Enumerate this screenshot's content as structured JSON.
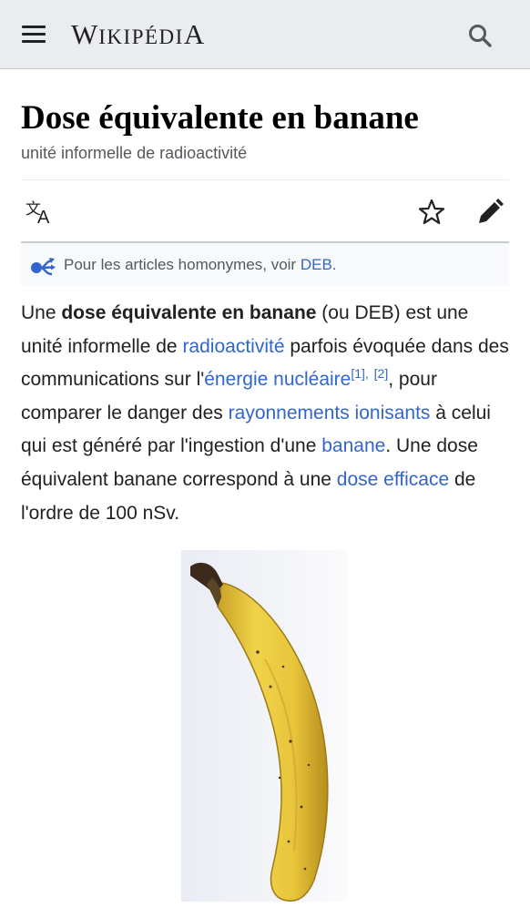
{
  "header": {
    "wordmark_first": "W",
    "wordmark_rest": "IKIPÉDI",
    "wordmark_last": "A",
    "menu_icon": "hamburger-menu-icon",
    "search_icon": "search-icon"
  },
  "article": {
    "title": "Dose équivalente en banane",
    "subtitle": "unité informelle de radioactivité"
  },
  "toolbar": {
    "language_icon": "translate-icon",
    "watch_icon": "star-icon",
    "edit_icon": "pencil-icon"
  },
  "hatnote": {
    "icon": "disambiguation-icon",
    "text": "Pour les articles homonymes, voir ",
    "link": "DEB",
    "end": "."
  },
  "paragraph": {
    "p1": "Une ",
    "bold": "dose équivalente en banane",
    "p2": " (ou DEB) est une unité informelle de ",
    "link_radioactivite": "radioactivité",
    "p3": " parfois évoquée dans des communications sur l'",
    "link_energie": "énergie nucléaire",
    "ref1": "[1],",
    "ref2": "[2]",
    "p4": ", pour comparer le danger des ",
    "link_rayonnements": "rayonnements ionisants",
    "p5": " à celui qui est généré par l'ingestion d'une ",
    "link_banane": "banane",
    "p6": ". Une dose équivalent banane correspond à une ",
    "link_dose": "dose efficace",
    "p7": " de l'ordre de 100 nSv."
  },
  "colors": {
    "link": "#3366cc",
    "header_bg": "#eaecf0",
    "text": "#202122"
  }
}
